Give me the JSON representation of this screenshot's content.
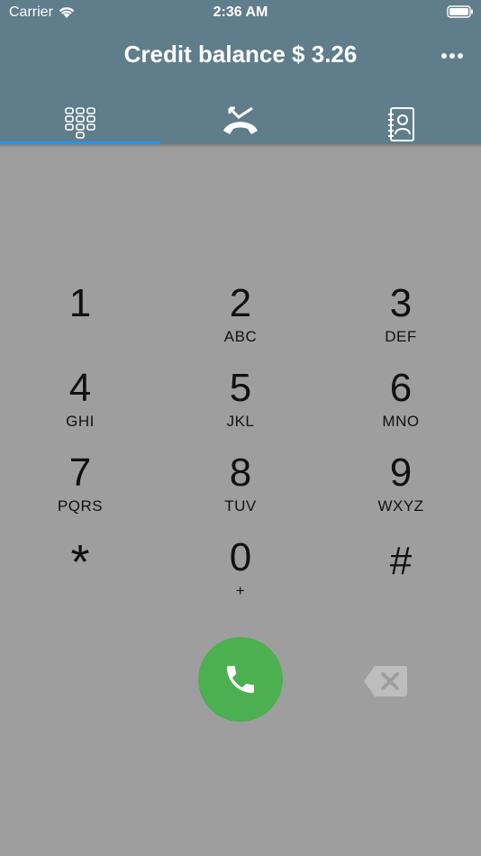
{
  "status_bar": {
    "carrier": "Carrier",
    "time": "2:36 AM"
  },
  "header": {
    "title": "Credit balance $ 3.26"
  },
  "tabs": [
    {
      "icon": "dialpad-icon",
      "selected": true
    },
    {
      "icon": "missed-call-icon",
      "selected": false
    },
    {
      "icon": "contacts-book-icon",
      "selected": false
    }
  ],
  "keypad": {
    "keys": [
      {
        "digit": "1",
        "letters": ""
      },
      {
        "digit": "2",
        "letters": "ABC"
      },
      {
        "digit": "3",
        "letters": "DEF"
      },
      {
        "digit": "4",
        "letters": "GHI"
      },
      {
        "digit": "5",
        "letters": "JKL"
      },
      {
        "digit": "6",
        "letters": "MNO"
      },
      {
        "digit": "7",
        "letters": "PQRS"
      },
      {
        "digit": "8",
        "letters": "TUV"
      },
      {
        "digit": "9",
        "letters": "WXYZ"
      },
      {
        "digit": "*",
        "letters": ""
      },
      {
        "digit": "0",
        "letters": "+"
      },
      {
        "digit": "#",
        "letters": ""
      }
    ]
  },
  "colors": {
    "header": "#607d8b",
    "background": "#9e9e9e",
    "tab_indicator": "#2196f3",
    "call_button": "#4caf50"
  },
  "icons": {
    "call": "phone-icon",
    "backspace": "backspace-icon",
    "menu": "more-horizontal-icon"
  }
}
